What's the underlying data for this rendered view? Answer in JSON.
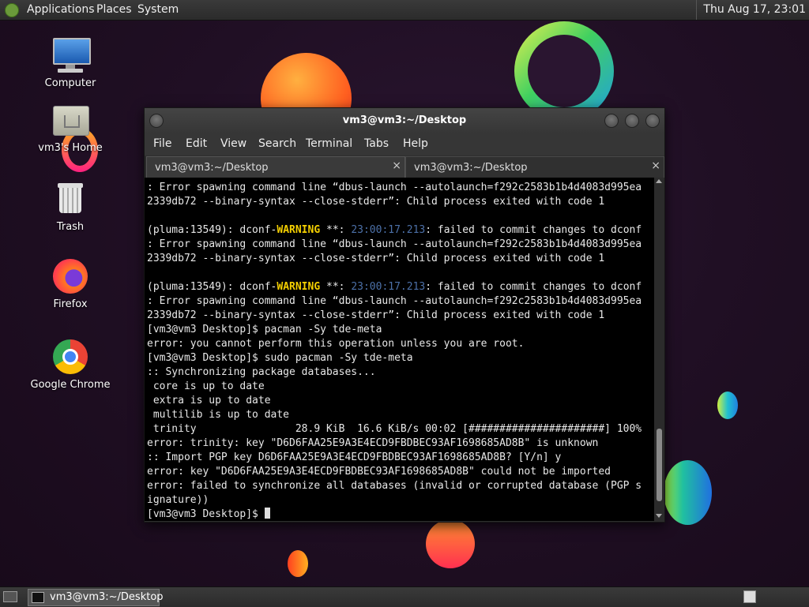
{
  "topbar": {
    "menus": [
      "Applications",
      "Places",
      "System"
    ],
    "clock": "Thu Aug 17, 23:01"
  },
  "desktop_icons": [
    {
      "label": "Computer",
      "icon": "computer-icon"
    },
    {
      "label": "vm3's Home",
      "icon": "home-folder-icon"
    },
    {
      "label": "Trash",
      "icon": "trash-icon"
    },
    {
      "label": "Firefox",
      "icon": "firefox-icon"
    },
    {
      "label": "Google Chrome",
      "icon": "chrome-icon"
    }
  ],
  "terminal": {
    "title": "vm3@vm3:~/Desktop",
    "menus": [
      "File",
      "Edit",
      "View",
      "Search",
      "Terminal",
      "Tabs",
      "Help"
    ],
    "tabs": [
      {
        "label": "vm3@vm3:~/Desktop",
        "close": "×"
      },
      {
        "label": "vm3@vm3:~/Desktop",
        "close": "×"
      }
    ],
    "lines": [
      ": Error spawning command line “dbus-launch --autolaunch=f292c2583b1b4d4083d995ea",
      "2339db72 --binary-syntax --close-stderr”: Child process exited with code 1",
      "",
      "(pluma:13549): dconf-|WARNING| **: |23:00:17.213|: failed to commit changes to dconf",
      ": Error spawning command line “dbus-launch --autolaunch=f292c2583b1b4d4083d995ea",
      "2339db72 --binary-syntax --close-stderr”: Child process exited with code 1",
      "",
      "(pluma:13549): dconf-|WARNING| **: |23:00:17.213|: failed to commit changes to dconf",
      ": Error spawning command line “dbus-launch --autolaunch=f292c2583b1b4d4083d995ea",
      "2339db72 --binary-syntax --close-stderr”: Child process exited with code 1",
      "[vm3@vm3 Desktop]$ pacman -Sy tde-meta",
      "error: you cannot perform this operation unless you are root.",
      "[vm3@vm3 Desktop]$ sudo pacman -Sy tde-meta",
      ":: Synchronizing package databases...",
      " core is up to date",
      " extra is up to date",
      " multilib is up to date",
      " trinity                28.9 KiB  16.6 KiB/s 00:02 [######################] 100%",
      "error: trinity: key \"D6D6FAA25E9A3E4ECD9FBDBEC93AF1698685AD8B\" is unknown",
      ":: Import PGP key D6D6FAA25E9A3E4ECD9FBDBEC93AF1698685AD8B? [Y/n] y",
      "error: key \"D6D6FAA25E9A3E4ECD9FBDBEC93AF1698685AD8B\" could not be imported",
      "error: failed to synchronize all databases (invalid or corrupted database (PGP s",
      "ignature))",
      "[vm3@vm3 Desktop]$ "
    ]
  },
  "taskbar": {
    "item": "vm3@vm3:~/Desktop"
  },
  "colors": {
    "warning": "#f5d000",
    "timestamp": "#4c70a8",
    "terminal_bg": "#000000"
  }
}
